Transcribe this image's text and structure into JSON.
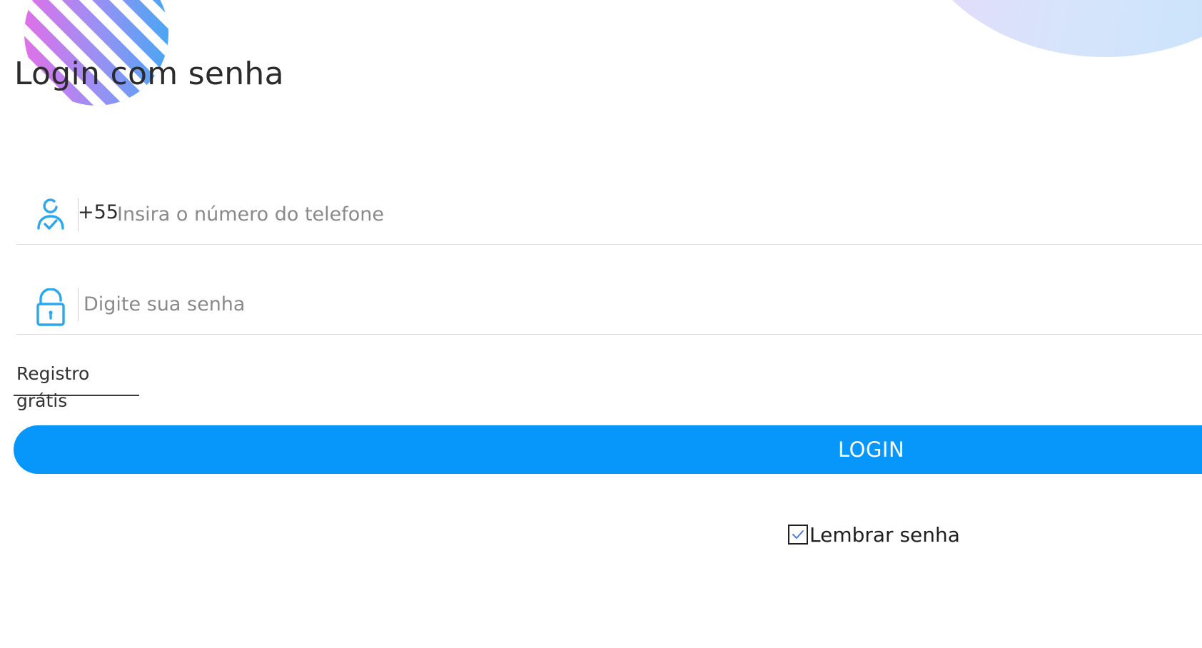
{
  "header": {
    "title": "Login com senha"
  },
  "form": {
    "phone": {
      "icon": "user-check-icon",
      "country_code": "+55",
      "placeholder": "Insira o número do telefone",
      "value": ""
    },
    "password": {
      "icon": "unlock-icon",
      "placeholder": "Digite sua senha",
      "value": ""
    },
    "register_link": "Registro grátis",
    "login_button": "LOGIN",
    "remember": {
      "label": "Lembrar senha",
      "checked": true
    }
  },
  "colors": {
    "accent": "#0797fb",
    "icon": "#29a7ef",
    "checkmark": "#4a7de0"
  }
}
